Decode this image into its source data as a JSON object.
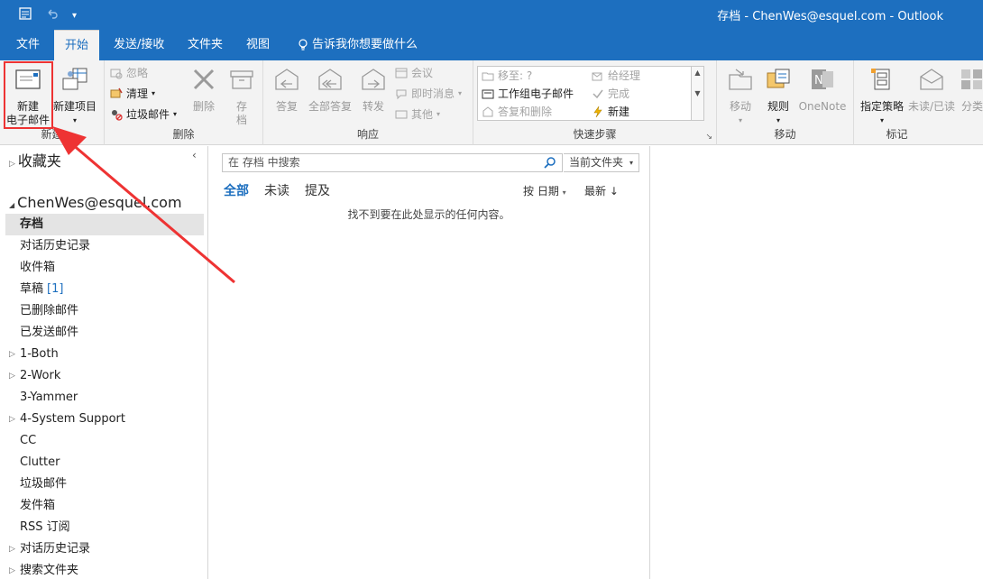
{
  "window": {
    "title": "存档 - ChenWes@esquel.com  -  Outlook"
  },
  "tabs": [
    "文件",
    "开始",
    "发送/接收",
    "文件夹",
    "视图"
  ],
  "tell_me": "告诉我你想要做什么",
  "ribbon": {
    "new_group": {
      "label": "新建",
      "new_email_line1": "新建",
      "new_email_line2": "电子邮件",
      "new_items": "新建项目"
    },
    "delete_group": {
      "label": "删除",
      "ignore": "忽略",
      "clean": "清理",
      "junk": "垃圾邮件",
      "delete": "删除",
      "archive_line1": "存",
      "archive_line2": "档"
    },
    "respond_group": {
      "label": "响应",
      "reply": "答复",
      "reply_all": "全部答复",
      "forward": "转发",
      "meeting": "会议",
      "im": "即时消息",
      "more": "其他"
    },
    "quick_steps": {
      "label": "快速步骤",
      "move_to": "移至: ?",
      "to_manager": "给经理",
      "team_email": "工作组电子邮件",
      "done": "完成",
      "reply_delete": "答复和删除",
      "create_new": "新建"
    },
    "move_group": {
      "label": "移动",
      "move": "移动",
      "rules": "规则",
      "onenote": "OneNote"
    },
    "tags_group": {
      "label": "标记",
      "policy": "指定策略",
      "unread_read": "未读/已读",
      "categorize": "分类"
    }
  },
  "nav": {
    "favorites": "收藏夹",
    "account": "ChenWes@esquel.com",
    "folders": [
      {
        "name": "存档",
        "count": "",
        "caret": ""
      },
      {
        "name": "对话历史记录",
        "count": "",
        "caret": ""
      },
      {
        "name": "收件箱",
        "count": "",
        "caret": ""
      },
      {
        "name": "草稿",
        "count": "[1]",
        "caret": ""
      },
      {
        "name": "已删除邮件",
        "count": "",
        "caret": ""
      },
      {
        "name": "已发送邮件",
        "count": "",
        "caret": ""
      },
      {
        "name": "1-Both",
        "count": "",
        "caret": "▷"
      },
      {
        "name": "2-Work",
        "count": "",
        "caret": "▷"
      },
      {
        "name": "3-Yammer",
        "count": "",
        "caret": ""
      },
      {
        "name": "4-System Support",
        "count": "",
        "caret": "▷"
      },
      {
        "name": "CC",
        "count": "",
        "caret": ""
      },
      {
        "name": "Clutter",
        "count": "",
        "caret": ""
      },
      {
        "name": "垃圾邮件",
        "count": "",
        "caret": ""
      },
      {
        "name": "发件箱",
        "count": "",
        "caret": ""
      },
      {
        "name": "RSS 订阅",
        "count": "",
        "caret": ""
      },
      {
        "name": "对话历史记录",
        "count": "",
        "caret": "▷"
      },
      {
        "name": "搜索文件夹",
        "count": "",
        "caret": "▷"
      }
    ]
  },
  "list": {
    "search_placeholder": "在 存档 中搜索",
    "scope": "当前文件夹",
    "filters": [
      "全部",
      "未读",
      "提及"
    ],
    "sort_by": "按 日期",
    "sort_order": "最新 ↓",
    "empty": "找不到要在此处显示的任何内容。"
  },
  "colors": {
    "brand": "#1d6fbf",
    "highlight": "#e33333"
  }
}
